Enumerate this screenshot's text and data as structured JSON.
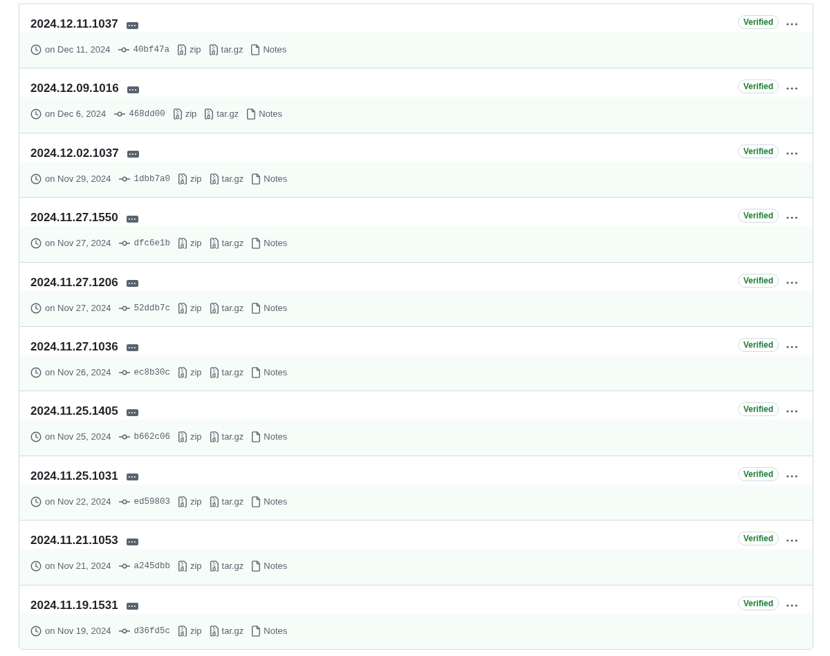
{
  "releases": [
    {
      "title": "2024.12.11.1037",
      "badge": "Verified",
      "date": "on Dec 11, 2024",
      "commit": "40bf47a",
      "links": [
        {
          "kind": "archive",
          "label": "zip"
        },
        {
          "kind": "archive",
          "label": "tar.gz"
        },
        {
          "kind": "notes",
          "label": "Notes"
        }
      ]
    },
    {
      "title": "2024.12.09.1016",
      "badge": "Verified",
      "date": "on Dec 6, 2024",
      "commit": "468dd00",
      "links": [
        {
          "kind": "archive",
          "label": "zip"
        },
        {
          "kind": "archive",
          "label": "tar.gz"
        },
        {
          "kind": "notes",
          "label": "Notes"
        }
      ]
    },
    {
      "title": "2024.12.02.1037",
      "badge": "Verified",
      "date": "on Nov 29, 2024",
      "commit": "1dbb7a0",
      "links": [
        {
          "kind": "archive",
          "label": "zip"
        },
        {
          "kind": "archive",
          "label": "tar.gz"
        },
        {
          "kind": "notes",
          "label": "Notes"
        }
      ]
    },
    {
      "title": "2024.11.27.1550",
      "badge": "Verified",
      "date": "on Nov 27, 2024",
      "commit": "dfc6e1b",
      "links": [
        {
          "kind": "archive",
          "label": "zip"
        },
        {
          "kind": "archive",
          "label": "tar.gz"
        },
        {
          "kind": "notes",
          "label": "Notes"
        }
      ]
    },
    {
      "title": "2024.11.27.1206",
      "badge": "Verified",
      "date": "on Nov 27, 2024",
      "commit": "52ddb7c",
      "links": [
        {
          "kind": "archive",
          "label": "zip"
        },
        {
          "kind": "archive",
          "label": "tar.gz"
        },
        {
          "kind": "notes",
          "label": "Notes"
        }
      ]
    },
    {
      "title": "2024.11.27.1036",
      "badge": "Verified",
      "date": "on Nov 26, 2024",
      "commit": "ec8b30c",
      "links": [
        {
          "kind": "archive",
          "label": "zip"
        },
        {
          "kind": "archive",
          "label": "tar.gz"
        },
        {
          "kind": "notes",
          "label": "Notes"
        }
      ]
    },
    {
      "title": "2024.11.25.1405",
      "badge": "Verified",
      "date": "on Nov 25, 2024",
      "commit": "b662c06",
      "links": [
        {
          "kind": "archive",
          "label": "zip"
        },
        {
          "kind": "archive",
          "label": "tar.gz"
        },
        {
          "kind": "notes",
          "label": "Notes"
        }
      ]
    },
    {
      "title": "2024.11.25.1031",
      "badge": "Verified",
      "date": "on Nov 22, 2024",
      "commit": "ed59803",
      "links": [
        {
          "kind": "archive",
          "label": "zip"
        },
        {
          "kind": "archive",
          "label": "tar.gz"
        },
        {
          "kind": "notes",
          "label": "Notes"
        }
      ]
    },
    {
      "title": "2024.11.21.1053",
      "badge": "Verified",
      "date": "on Nov 21, 2024",
      "commit": "a245dbb",
      "links": [
        {
          "kind": "archive",
          "label": "zip"
        },
        {
          "kind": "archive",
          "label": "tar.gz"
        },
        {
          "kind": "notes",
          "label": "Notes"
        }
      ]
    },
    {
      "title": "2024.11.19.1531",
      "badge": "Verified",
      "date": "on Nov 19, 2024",
      "commit": "d36fd5c",
      "links": [
        {
          "kind": "archive",
          "label": "zip"
        },
        {
          "kind": "archive",
          "label": "tar.gz"
        },
        {
          "kind": "notes",
          "label": "Notes"
        }
      ]
    }
  ]
}
